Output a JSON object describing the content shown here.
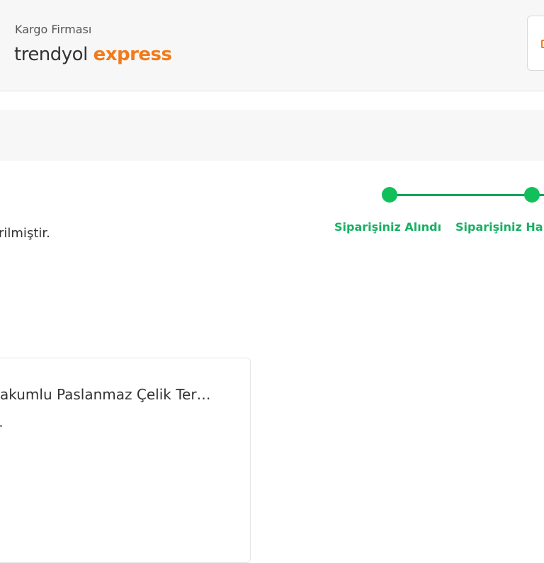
{
  "header": {
    "cargo_label": "Kargo Firması",
    "logo_part1": "trendyol",
    "logo_part2": "express"
  },
  "status": {
    "message_fragment": "rilmiştir."
  },
  "tracker": {
    "steps": [
      {
        "label": "Siparişiniz Alındı",
        "completed": true
      },
      {
        "label": "Siparişiniz Ha",
        "completed": true
      }
    ],
    "color": "#11c05a"
  },
  "product": {
    "name_fragment": "akumlu Paslanmaz Çelik Ter…"
  },
  "colors": {
    "brand": "#f27a1a",
    "success": "#18b063",
    "text": "#333333"
  }
}
